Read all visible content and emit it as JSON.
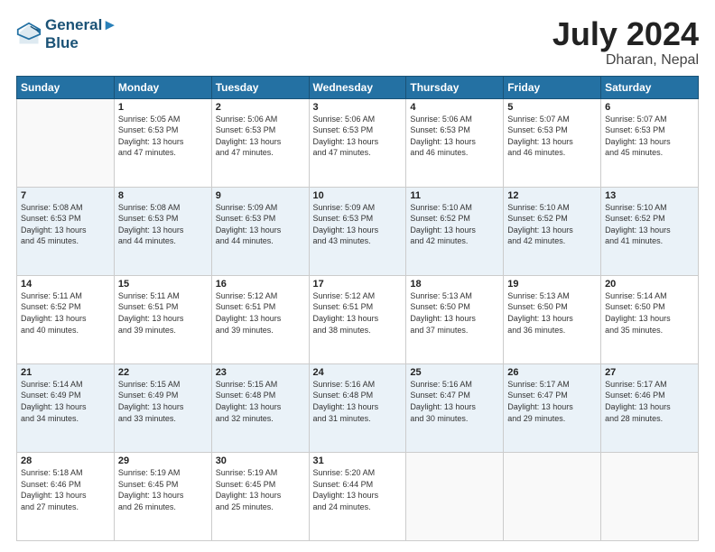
{
  "logo": {
    "line1": "General",
    "line2": "Blue"
  },
  "header": {
    "month_year": "July 2024",
    "location": "Dharan, Nepal"
  },
  "weekdays": [
    "Sunday",
    "Monday",
    "Tuesday",
    "Wednesday",
    "Thursday",
    "Friday",
    "Saturday"
  ],
  "weeks": [
    [
      {
        "day": "",
        "info": ""
      },
      {
        "day": "1",
        "info": "Sunrise: 5:05 AM\nSunset: 6:53 PM\nDaylight: 13 hours\nand 47 minutes."
      },
      {
        "day": "2",
        "info": "Sunrise: 5:06 AM\nSunset: 6:53 PM\nDaylight: 13 hours\nand 47 minutes."
      },
      {
        "day": "3",
        "info": "Sunrise: 5:06 AM\nSunset: 6:53 PM\nDaylight: 13 hours\nand 47 minutes."
      },
      {
        "day": "4",
        "info": "Sunrise: 5:06 AM\nSunset: 6:53 PM\nDaylight: 13 hours\nand 46 minutes."
      },
      {
        "day": "5",
        "info": "Sunrise: 5:07 AM\nSunset: 6:53 PM\nDaylight: 13 hours\nand 46 minutes."
      },
      {
        "day": "6",
        "info": "Sunrise: 5:07 AM\nSunset: 6:53 PM\nDaylight: 13 hours\nand 45 minutes."
      }
    ],
    [
      {
        "day": "7",
        "info": "Sunrise: 5:08 AM\nSunset: 6:53 PM\nDaylight: 13 hours\nand 45 minutes."
      },
      {
        "day": "8",
        "info": "Sunrise: 5:08 AM\nSunset: 6:53 PM\nDaylight: 13 hours\nand 44 minutes."
      },
      {
        "day": "9",
        "info": "Sunrise: 5:09 AM\nSunset: 6:53 PM\nDaylight: 13 hours\nand 44 minutes."
      },
      {
        "day": "10",
        "info": "Sunrise: 5:09 AM\nSunset: 6:53 PM\nDaylight: 13 hours\nand 43 minutes."
      },
      {
        "day": "11",
        "info": "Sunrise: 5:10 AM\nSunset: 6:52 PM\nDaylight: 13 hours\nand 42 minutes."
      },
      {
        "day": "12",
        "info": "Sunrise: 5:10 AM\nSunset: 6:52 PM\nDaylight: 13 hours\nand 42 minutes."
      },
      {
        "day": "13",
        "info": "Sunrise: 5:10 AM\nSunset: 6:52 PM\nDaylight: 13 hours\nand 41 minutes."
      }
    ],
    [
      {
        "day": "14",
        "info": "Sunrise: 5:11 AM\nSunset: 6:52 PM\nDaylight: 13 hours\nand 40 minutes."
      },
      {
        "day": "15",
        "info": "Sunrise: 5:11 AM\nSunset: 6:51 PM\nDaylight: 13 hours\nand 39 minutes."
      },
      {
        "day": "16",
        "info": "Sunrise: 5:12 AM\nSunset: 6:51 PM\nDaylight: 13 hours\nand 39 minutes."
      },
      {
        "day": "17",
        "info": "Sunrise: 5:12 AM\nSunset: 6:51 PM\nDaylight: 13 hours\nand 38 minutes."
      },
      {
        "day": "18",
        "info": "Sunrise: 5:13 AM\nSunset: 6:50 PM\nDaylight: 13 hours\nand 37 minutes."
      },
      {
        "day": "19",
        "info": "Sunrise: 5:13 AM\nSunset: 6:50 PM\nDaylight: 13 hours\nand 36 minutes."
      },
      {
        "day": "20",
        "info": "Sunrise: 5:14 AM\nSunset: 6:50 PM\nDaylight: 13 hours\nand 35 minutes."
      }
    ],
    [
      {
        "day": "21",
        "info": "Sunrise: 5:14 AM\nSunset: 6:49 PM\nDaylight: 13 hours\nand 34 minutes."
      },
      {
        "day": "22",
        "info": "Sunrise: 5:15 AM\nSunset: 6:49 PM\nDaylight: 13 hours\nand 33 minutes."
      },
      {
        "day": "23",
        "info": "Sunrise: 5:15 AM\nSunset: 6:48 PM\nDaylight: 13 hours\nand 32 minutes."
      },
      {
        "day": "24",
        "info": "Sunrise: 5:16 AM\nSunset: 6:48 PM\nDaylight: 13 hours\nand 31 minutes."
      },
      {
        "day": "25",
        "info": "Sunrise: 5:16 AM\nSunset: 6:47 PM\nDaylight: 13 hours\nand 30 minutes."
      },
      {
        "day": "26",
        "info": "Sunrise: 5:17 AM\nSunset: 6:47 PM\nDaylight: 13 hours\nand 29 minutes."
      },
      {
        "day": "27",
        "info": "Sunrise: 5:17 AM\nSunset: 6:46 PM\nDaylight: 13 hours\nand 28 minutes."
      }
    ],
    [
      {
        "day": "28",
        "info": "Sunrise: 5:18 AM\nSunset: 6:46 PM\nDaylight: 13 hours\nand 27 minutes."
      },
      {
        "day": "29",
        "info": "Sunrise: 5:19 AM\nSunset: 6:45 PM\nDaylight: 13 hours\nand 26 minutes."
      },
      {
        "day": "30",
        "info": "Sunrise: 5:19 AM\nSunset: 6:45 PM\nDaylight: 13 hours\nand 25 minutes."
      },
      {
        "day": "31",
        "info": "Sunrise: 5:20 AM\nSunset: 6:44 PM\nDaylight: 13 hours\nand 24 minutes."
      },
      {
        "day": "",
        "info": ""
      },
      {
        "day": "",
        "info": ""
      },
      {
        "day": "",
        "info": ""
      }
    ]
  ]
}
